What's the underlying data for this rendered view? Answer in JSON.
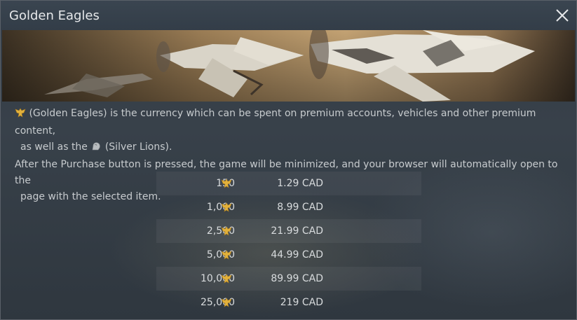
{
  "window": {
    "title": "Golden Eagles",
    "close_icon": "close-icon"
  },
  "info": {
    "line1_text": "(Golden Eagles) is the currency which can be spent on premium accounts, vehicles and other premium content,",
    "line2_prefix": "as well as the",
    "line2_suffix": "(Silver Lions).",
    "line3_text": "After the Purchase button is pressed, the game will be minimized, and your browser will automatically open to the",
    "line4_text": "page with the selected item.",
    "golden_eagle_icon": "golden-eagle-icon",
    "silver_lion_icon": "silver-lion-icon"
  },
  "packages": [
    {
      "amount": "150",
      "price": "1.29 CAD"
    },
    {
      "amount": "1,000",
      "price": "8.99 CAD"
    },
    {
      "amount": "2,500",
      "price": "21.99 CAD"
    },
    {
      "amount": "5,000",
      "price": "44.99 CAD"
    },
    {
      "amount": "10,000",
      "price": "89.99 CAD"
    },
    {
      "amount": "25,000",
      "price": "219 CAD"
    }
  ],
  "colors": {
    "gold": "#e2b13c",
    "text": "#c7cbce",
    "title": "#e6e8ea"
  }
}
